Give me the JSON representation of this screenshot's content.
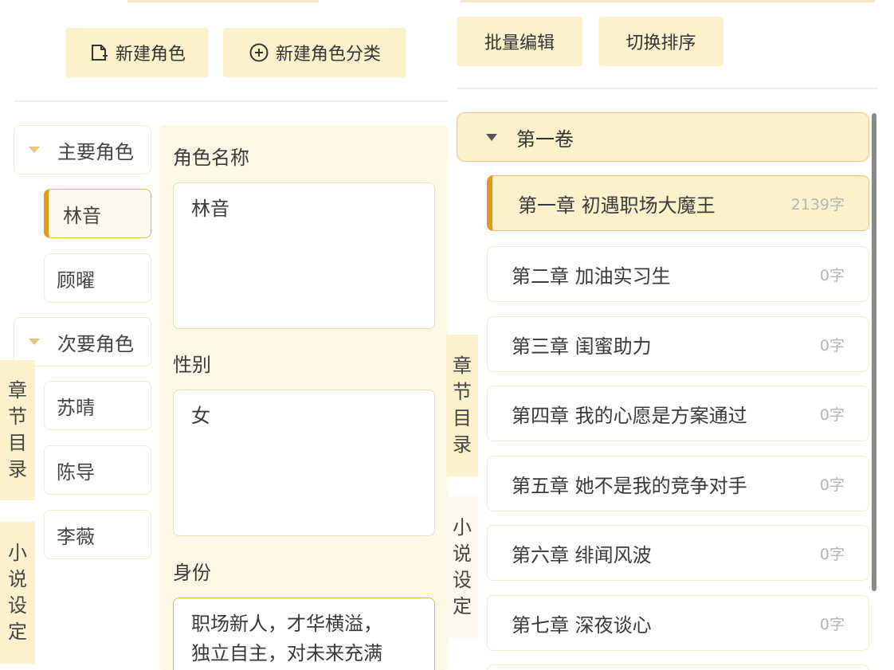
{
  "toolbar_left": {
    "new_character": "新建角色",
    "new_category": "新建角色分类"
  },
  "toolbar_right": {
    "batch_edit": "批量编辑",
    "toggle_sort": "切换排序"
  },
  "categories": [
    {
      "name": "主要角色",
      "characters": [
        "林音",
        "顾曜"
      ]
    },
    {
      "name": "次要角色",
      "characters": [
        "苏晴",
        "陈导",
        "李薇"
      ]
    }
  ],
  "side_tabs": {
    "chapter_toc": "章节目录",
    "novel_settings": "小说设定"
  },
  "form": {
    "name_label": "角色名称",
    "name_value": "林音",
    "gender_label": "性别",
    "gender_value": "女",
    "identity_label": "身份",
    "identity_line1": "职场新人，才华横溢，",
    "identity_line2": "独立自主，对未来充满"
  },
  "volume": {
    "title": "第一卷"
  },
  "chapters": [
    {
      "title": "第一章 初遇职场大魔王",
      "count": "2139字"
    },
    {
      "title": "第二章 加油实习生",
      "count": "0字"
    },
    {
      "title": "第三章 闺蜜助力",
      "count": "0字"
    },
    {
      "title": "第四章 我的心愿是方案通过",
      "count": "0字"
    },
    {
      "title": "第五章 她不是我的竞争对手",
      "count": "0字"
    },
    {
      "title": "第六章 绯闻风波",
      "count": "0字"
    },
    {
      "title": "第七章 深夜谈心",
      "count": "0字"
    }
  ],
  "colors": {
    "accent": "#e29a1d",
    "button_bg": "#fdf1cc",
    "panel_bg": "#fef7e6"
  }
}
